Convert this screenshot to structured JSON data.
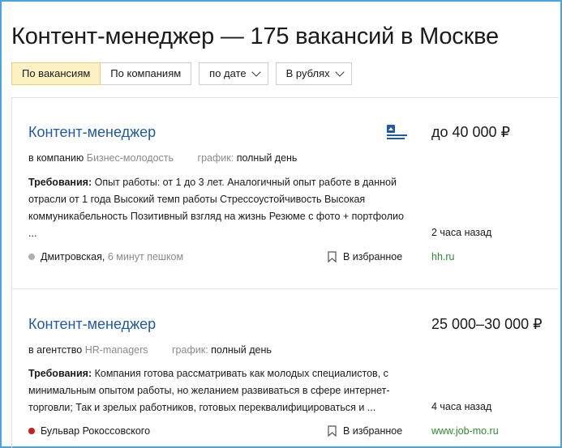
{
  "page": {
    "title": "Контент-менеджер — 175 вакансий в Москве"
  },
  "filters": {
    "by_vacancies": "По вакансиям",
    "by_companies": "По компаниям",
    "sort": "по дате",
    "currency": "В рублях"
  },
  "colors": {
    "link_blue": "#1e5aa8",
    "source_green": "#2e8b2e",
    "active_tab_bg": "#fdf0c3",
    "metro_grey": "#b0b0b0",
    "metro_red": "#d31a1a",
    "frame_blue": "#4aa3df"
  },
  "vacancies": [
    {
      "title": "Контент-менеджер",
      "employer_prefix": "в компанию",
      "employer": "Бизнес-молодость",
      "schedule_label": "график:",
      "schedule": "полный день",
      "req_label": "Требования:",
      "requirements": "Опыт работы: от 1 до 3 лет. Аналогичный опыт работе в данной отрасли от 1 года Высокий темп работы Стрессоустойчивость Высокая коммуникабельность Позитивный взгляд на жизнь Резюме с фото + портфолио ...",
      "salary": "до 40 000 ₽",
      "posted": "2 часа назад",
      "source": "hh.ru",
      "metro": "Дмитровская",
      "walk": "6 минут пешком",
      "favorite": "В избранное",
      "logo_icon": "business-youth-logo-icon"
    },
    {
      "title": "Контент-менеджер",
      "employer_prefix": "в агентство",
      "employer": "HR-managers",
      "schedule_label": "график:",
      "schedule": "полный день",
      "req_label": "Требования:",
      "requirements": "Компания готова рассматривать как молодых специалистов, с минимальным опытом работы, но желанием развиваться в сфере интернет-торговли; Так и зрелых работников, готовых переквалифицироваться и ...",
      "salary": "25 000–30 000 ₽",
      "posted": "4 часа назад",
      "source": "www.job-mo.ru",
      "metro": "Бульвар Рокоссовского",
      "walk": "",
      "favorite": "В избранное"
    }
  ]
}
